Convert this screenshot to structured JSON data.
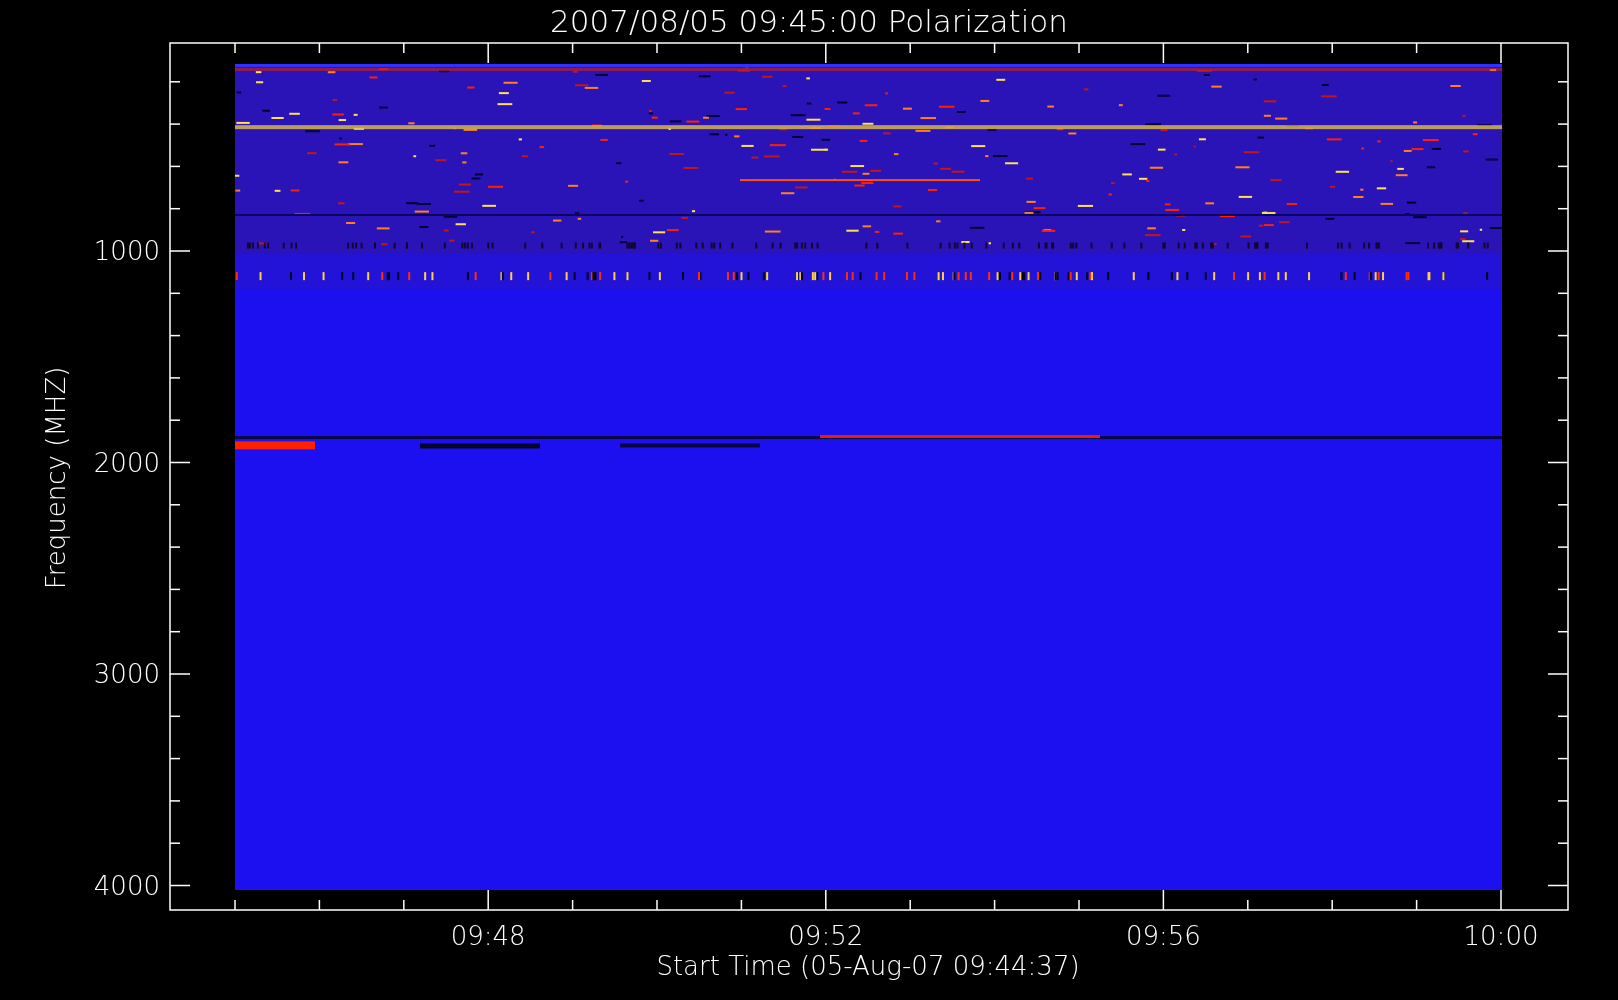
{
  "title": "2007/08/05 09:45:00 Polarization",
  "y_axis": {
    "label": "Frequency (MHZ)",
    "ticks": [
      "1000",
      "2000",
      "3000",
      "4000"
    ]
  },
  "x_axis": {
    "label": "Start Time (05-Aug-07 09:44:37)",
    "ticks": [
      "09:48",
      "09:52",
      "09:56",
      "10:00"
    ]
  }
}
